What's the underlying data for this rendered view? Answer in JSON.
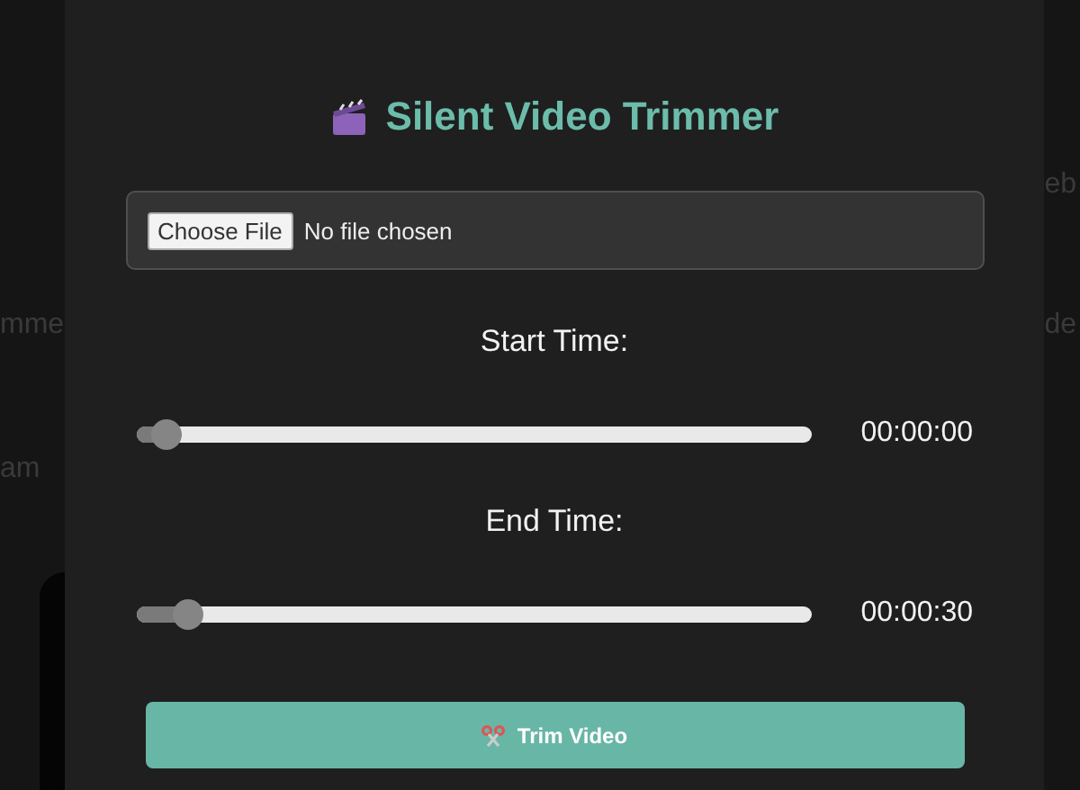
{
  "background": {
    "left_fragments": [
      "mme",
      "am"
    ],
    "right_fragments": [
      "eb",
      "de"
    ]
  },
  "dialog": {
    "title": "Silent Video Trimmer",
    "file_input": {
      "button": "Choose File",
      "status": "No file chosen"
    },
    "sliders": [
      {
        "label": "Start Time:",
        "level": 0.045,
        "reading": "00:00:00"
      },
      {
        "label": "End Time:",
        "level": 0.075,
        "reading": "00:00:30"
      }
    ],
    "button": "Trim Video"
  }
}
